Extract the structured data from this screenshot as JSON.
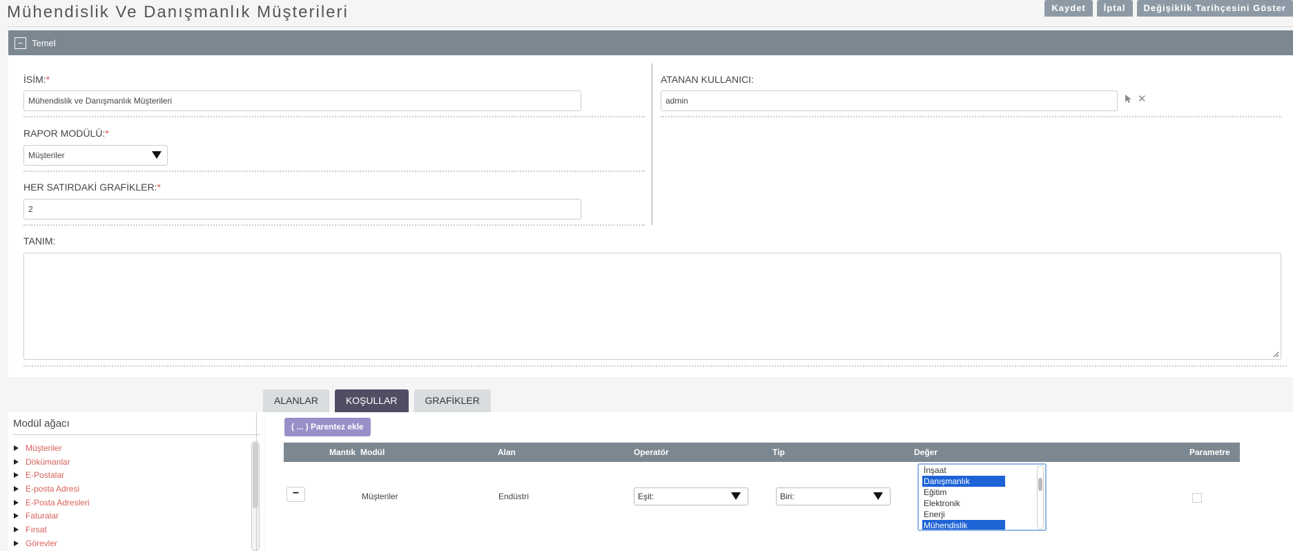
{
  "page": {
    "title": "Mühendislik Ve Danışmanlık Müşterileri",
    "actions": {
      "save": "Kaydet",
      "cancel": "İptal",
      "history": "Değişiklik Tarihçesini Göster"
    }
  },
  "panel": {
    "header": "Temel",
    "collapse_glyph": "−",
    "name_label": "İSİM:",
    "name_value": "Mühendislik ve Danışmanlık Müşterileri",
    "module_label": "RAPOR MODÜLÜ:",
    "module_value": "Müşteriler",
    "charts_label": "HER SATIRDAKİ GRAFİKLER:",
    "charts_value": "2",
    "assigned_label": "ATANAN KULLANICI:",
    "assigned_value": "admin",
    "description_label": "TANIM:",
    "required_mark": "*",
    "clear_glyph": "✕"
  },
  "tabs": [
    {
      "label": "ALANLAR",
      "active": false
    },
    {
      "label": "KOŞULLAR",
      "active": true
    },
    {
      "label": "GRAFİKLER",
      "active": false
    }
  ],
  "tree": {
    "title": "Modül ağacı",
    "items": [
      "Müşteriler",
      "Dökümanlar",
      "E-Postalar",
      "E-posta Adresi",
      "E-Posta Adresleri",
      "Faturalar",
      "Fırsat",
      "Görevler"
    ]
  },
  "conditions": {
    "paren_button": "( ... ) Parentez ekle",
    "headers": {
      "logic": "Mantık",
      "module": "Modül",
      "field": "Alan",
      "operator": "Operatör",
      "type": "Tip",
      "value": "Değer",
      "parameter": "Parametre"
    },
    "row": {
      "remove_glyph": "−",
      "module": "Müşteriler",
      "field": "Endüstri",
      "operator": "Eşit:",
      "type": "Biri:",
      "options": [
        {
          "label": "İnşaat",
          "selected": false
        },
        {
          "label": "Danışmanlık",
          "selected": true
        },
        {
          "label": "Eğitim",
          "selected": false
        },
        {
          "label": "Elektronik",
          "selected": false
        },
        {
          "label": "Enerji",
          "selected": false
        },
        {
          "label": "Mühendislik",
          "selected": true
        }
      ],
      "parameter_checked": false
    }
  }
}
